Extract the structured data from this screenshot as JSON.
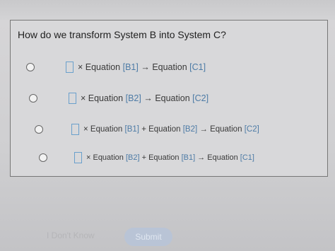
{
  "question": {
    "prompt": "How do we transform System B into System C?"
  },
  "options": [
    {
      "times": "× Equation",
      "lhs": "[B1]",
      "arrow": "→ Equation",
      "rhs": "[C1]"
    },
    {
      "times": "× Equation",
      "lhs": "[B2]",
      "arrow": "→ Equation",
      "rhs": "[C2]"
    },
    {
      "times": "× Equation",
      "lhs": "[B1]",
      "plus": "+ Equation",
      "lhs2": "[B2]",
      "arrow": "→ Equation",
      "rhs": "[C2]"
    },
    {
      "times": "× Equation",
      "lhs": "[B2]",
      "plus": "+ Equation",
      "lhs2": "[B1]",
      "arrow": "→ Equation",
      "rhs": "[C1]"
    }
  ],
  "actions": {
    "dont_know_label": "I Don't Know",
    "submit_label": "Submit"
  },
  "colors": {
    "accent": "#4d7ba6",
    "submit_bg": "#b9c4d6"
  }
}
